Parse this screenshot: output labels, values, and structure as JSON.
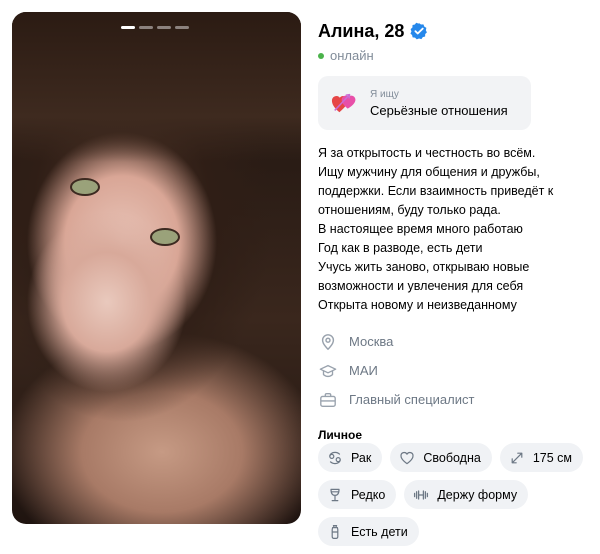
{
  "profile": {
    "name_age": "Алина, 28",
    "status": "онлайн",
    "photo_count": 4,
    "active_photo": 1
  },
  "looking_for": {
    "label": "Я ищу",
    "value": "Серьёзные отношения",
    "icon": "hearts-icon"
  },
  "bio": "Я за открытость и честность во всём.\nИщу мужчину для общения и дружбы, поддержки. Если взаимность приведёт к отношениям, буду только рада.\nВ настоящее время много работаю\nГод как в разводе, есть дети\nУчусь жить заново, открываю новые возможности и увлечения для себя\nОткрыта новому и неизведанному",
  "details": {
    "city": "Москва",
    "education": "МАИ",
    "job": "Главный специалист"
  },
  "personal": {
    "title": "Личное",
    "chips": {
      "zodiac": "Рак",
      "relationship": "Свободна",
      "height": "175 см",
      "drinking": "Редко",
      "sport": "Держу форму",
      "kids": "Есть дети"
    }
  },
  "colors": {
    "verified": "#2688eb",
    "online": "#4bb34b",
    "secondary_text": "#818c99",
    "chip_bg": "#f0f2f5"
  }
}
